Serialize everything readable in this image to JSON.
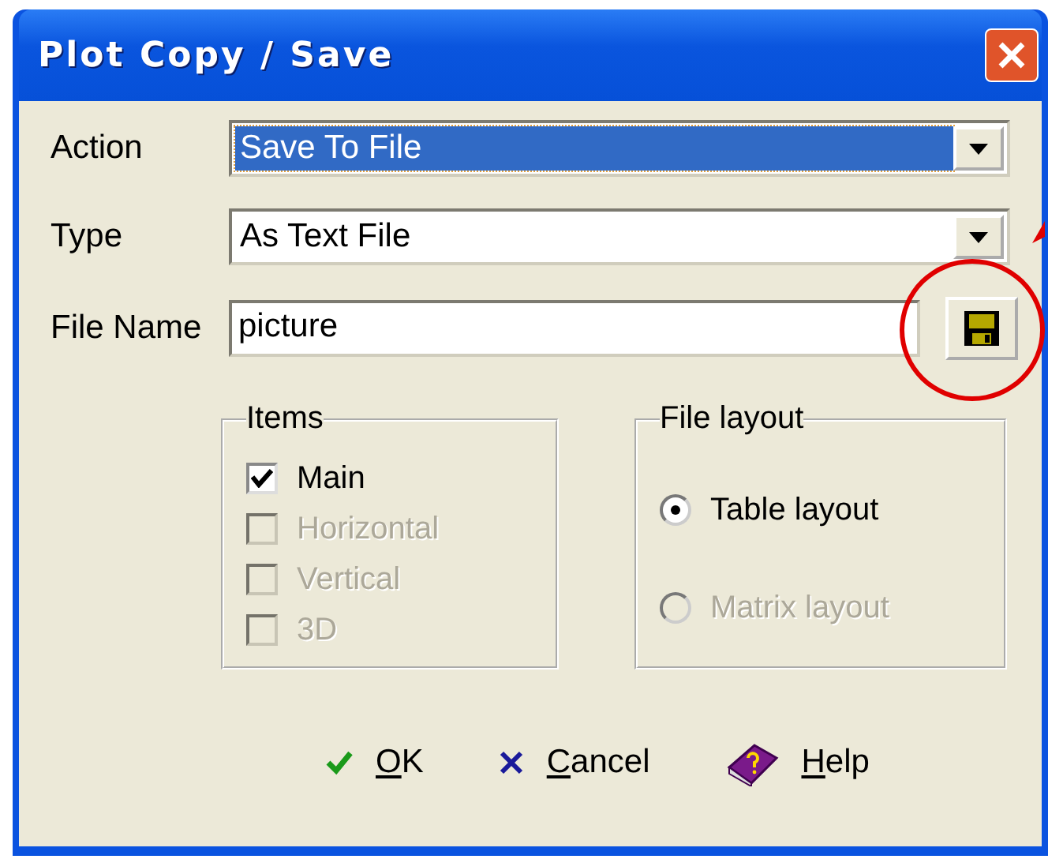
{
  "window": {
    "title": "Plot Copy / Save"
  },
  "fields": [
    {
      "kind": "combo",
      "label": "Action",
      "value": "Save To File",
      "selected": true
    },
    {
      "kind": "combo",
      "label": "Type",
      "value": "As Text File",
      "selected": false
    },
    {
      "kind": "text",
      "label": "File Name",
      "value": "picture"
    }
  ],
  "items": {
    "title": "Items",
    "options": [
      {
        "label": "Main",
        "checked": true,
        "disabled": false
      },
      {
        "label": "Horizontal",
        "checked": false,
        "disabled": true
      },
      {
        "label": "Vertical",
        "checked": false,
        "disabled": true
      },
      {
        "label": "3D",
        "checked": false,
        "disabled": true
      }
    ]
  },
  "file_layout": {
    "title": "File layout",
    "options": [
      {
        "label": "Table layout",
        "selected": true,
        "disabled": false
      },
      {
        "label": "Matrix layout",
        "selected": false,
        "disabled": true
      }
    ]
  },
  "buttons": [
    {
      "kind": "ok",
      "label": "OK"
    },
    {
      "kind": "cancel",
      "label": "Cancel"
    },
    {
      "kind": "help",
      "label": "Help"
    }
  ]
}
